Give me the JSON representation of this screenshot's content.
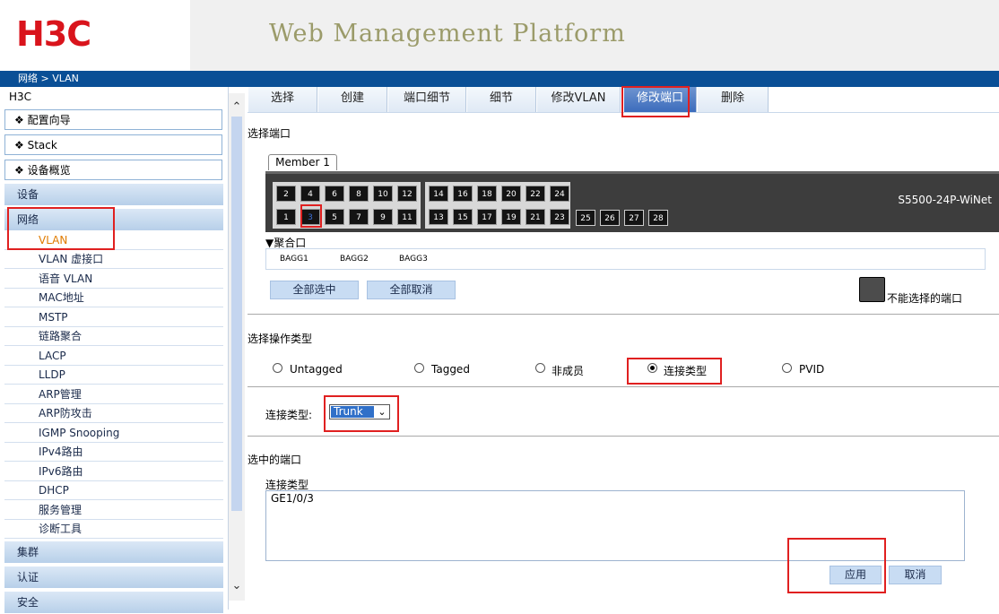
{
  "header": {
    "logo": "H3C",
    "title": "Web Management Platform"
  },
  "breadcrumb": "网络 > VLAN",
  "sidebar": {
    "root": "H3C",
    "top_items": [
      "❖ 配置向导",
      "❖ Stack",
      "❖ 设备概览"
    ],
    "sections": [
      "设备",
      "网络"
    ],
    "network_items": [
      "VLAN",
      "VLAN 虚接口",
      "语音 VLAN",
      "MAC地址",
      "MSTP",
      "链路聚合",
      "LACP",
      "LLDP",
      "ARP管理",
      "ARP防攻击",
      "IGMP Snooping",
      "IPv4路由",
      "IPv6路由",
      "DHCP",
      "服务管理",
      "诊断工具"
    ],
    "bottom_sections": [
      "集群",
      "认证",
      "安全"
    ],
    "active_item": "VLAN",
    "active_color": "#e07b00"
  },
  "tabs": [
    "选择",
    "创建",
    "端口细节",
    "细节",
    "修改VLAN",
    "修改端口",
    "删除"
  ],
  "active_tab": "修改端口",
  "select_ports": {
    "label": "选择端口",
    "member_tab": "Member 1",
    "top_row_a": [
      "2",
      "4",
      "6",
      "8",
      "10",
      "12"
    ],
    "bottom_row_a": [
      "1",
      "3",
      "5",
      "7",
      "9",
      "11"
    ],
    "top_row_b": [
      "14",
      "16",
      "18",
      "20",
      "22",
      "24"
    ],
    "bottom_row_b": [
      "13",
      "15",
      "17",
      "19",
      "21",
      "23"
    ],
    "sfp_row": [
      "25",
      "26",
      "27",
      "28"
    ],
    "selected_port": "3",
    "model": "S5500-24P-WiNet",
    "agg_label": "▼聚合口",
    "aggs": [
      "BAGG1",
      "BAGG2",
      "BAGG3"
    ],
    "select_all": "全部选中",
    "deselect_all": "全部取消",
    "legend": "不能选择的端口"
  },
  "operation": {
    "label": "选择操作类型",
    "options": [
      "Untagged",
      "Tagged",
      "非成员",
      "连接类型",
      "PVID"
    ],
    "selected": "连接类型"
  },
  "link_type": {
    "label": "连接类型:",
    "value": "Trunk"
  },
  "selected_ports": {
    "label": "选中的端口",
    "sub_label": "连接类型",
    "value": "GE1/0/3"
  },
  "actions": {
    "apply": "应用",
    "cancel": "取消"
  },
  "colors": {
    "header_bar": "#0a4f96",
    "logo": "#d9141c",
    "highlight": "#e02020",
    "active_tab": "#3c6cbc"
  }
}
